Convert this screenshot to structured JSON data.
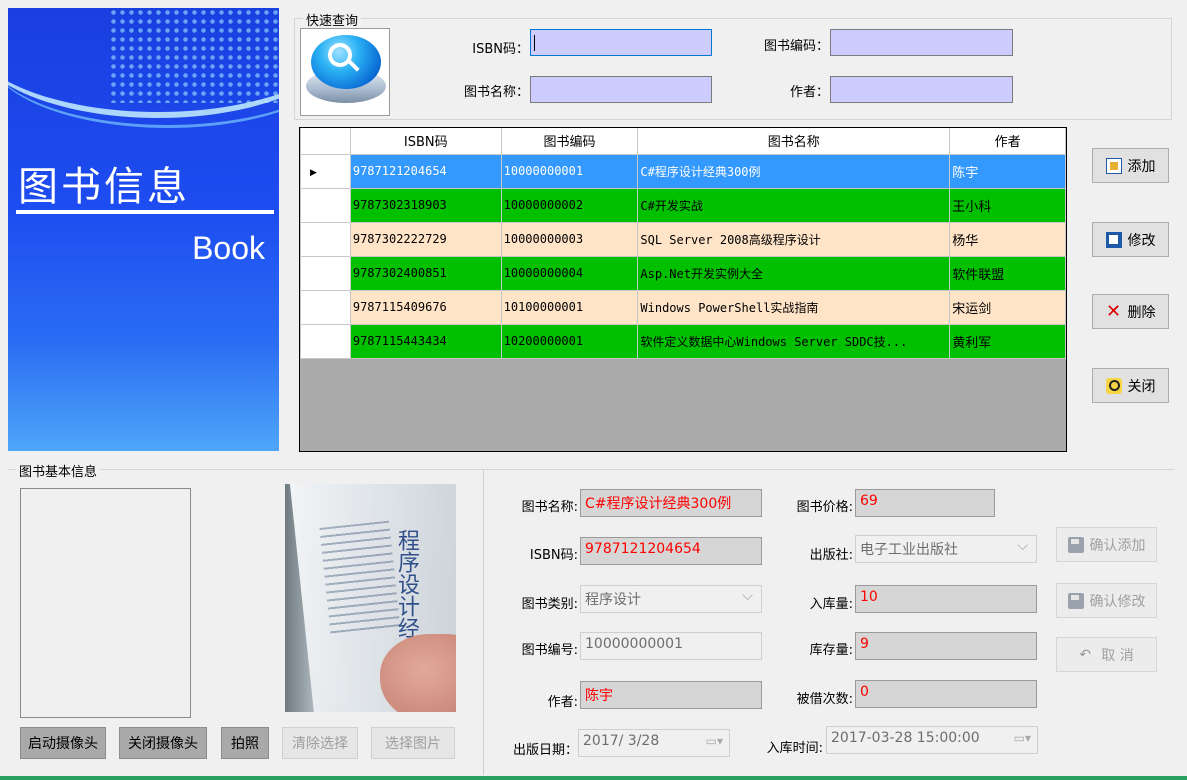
{
  "banner": {
    "title": "图书信息",
    "subtitle": "Book"
  },
  "quick_search": {
    "title": "快速查询",
    "isbn_label": "ISBN码：",
    "code_label": "图书编码：",
    "name_label": "图书名称：",
    "author_label": "作者：",
    "isbn_value": "",
    "code_value": "",
    "name_value": "",
    "author_value": ""
  },
  "grid": {
    "columns": [
      "ISBN码",
      "图书编码",
      "图书名称",
      "作者"
    ],
    "rows": [
      {
        "isbn": "9787121204654",
        "code": "10000000001",
        "name": "C#程序设计经典300例",
        "author": "陈宇",
        "style": "sel"
      },
      {
        "isbn": "9787302318903",
        "code": "10000000002",
        "name": "C#开发实战",
        "author": "王小科",
        "style": "green"
      },
      {
        "isbn": "9787302222729",
        "code": "10000000003",
        "name": "SQL Server 2008高级程序设计",
        "author": "杨华",
        "style": "peach"
      },
      {
        "isbn": "9787302400851",
        "code": "10000000004",
        "name": "Asp.Net开发实例大全",
        "author": "软件联盟",
        "style": "green"
      },
      {
        "isbn": "9787115409676",
        "code": "10100000001",
        "name": "Windows PowerShell实战指南",
        "author": "宋运剑",
        "style": "peach"
      },
      {
        "isbn": "9787115443434",
        "code": "10200000001",
        "name": "软件定义数据中心Windows Server SDDC技...",
        "author": "黄利军",
        "style": "green"
      }
    ]
  },
  "side_buttons": {
    "add": "添加",
    "edit": "修改",
    "delete": "删除",
    "close": "关闭"
  },
  "basic_info": {
    "title": "图书基本信息",
    "camera_start": "启动摄像头",
    "camera_close": "关闭摄像头",
    "capture": "拍照",
    "clear_selection": "清除选择",
    "select_image": "选择图片",
    "cover_text": "程序设计经典"
  },
  "form": {
    "name_label": "图书名称:",
    "name_value": "C#程序设计经典300例",
    "price_label": "图书价格:",
    "price_value": "69",
    "isbn_label": "ISBN码:",
    "isbn_value": "9787121204654",
    "publisher_label": "出版社:",
    "publisher_value": "电子工业出版社",
    "category_label": "图书类别:",
    "category_value": "程序设计",
    "instock_label": "入库量:",
    "instock_value": "10",
    "code_label": "图书编号:",
    "code_value": "10000000001",
    "stock_label": "库存量:",
    "stock_value": "9",
    "author_label": "作者:",
    "author_value": "陈宇",
    "borrow_label": "被借次数:",
    "borrow_value": "0",
    "pubdate_label": "出版日期：",
    "pubdate_value": "2017/ 3/28",
    "intime_label": "入库时间:",
    "intime_value": "2017-03-28 15:00:00"
  },
  "action_buttons": {
    "confirm_add": "确认添加",
    "confirm_edit": "确认修改",
    "cancel": "取 消"
  }
}
